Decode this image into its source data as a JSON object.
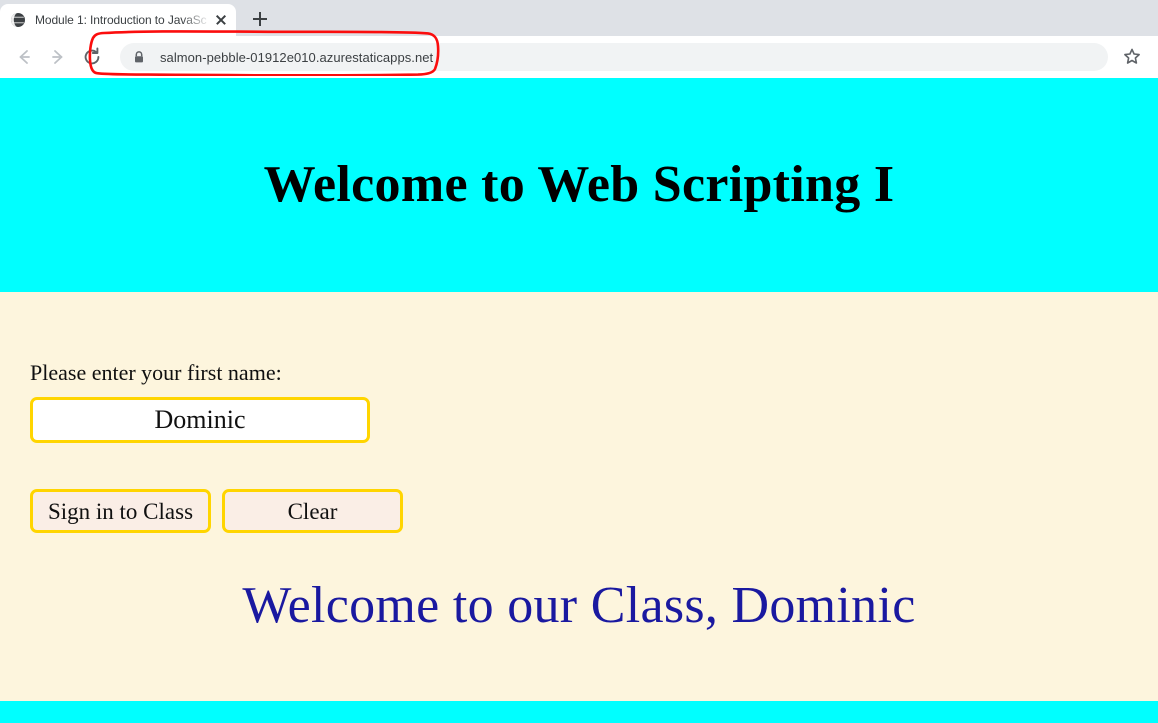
{
  "browser": {
    "tab": {
      "title": "Module 1: Introduction to JavaSc",
      "favicon_name": "globe-icon",
      "close_label": "Close tab"
    },
    "new_tab_label": "New Tab",
    "nav": {
      "back_label": "Back",
      "forward_label": "Forward",
      "reload_label": "Reload"
    },
    "omnibox": {
      "url": "salmon-pebble-01912e010.azurestaticapps.net",
      "security_icon": "lock-icon",
      "placeholder": "Search Google or type a URL"
    },
    "bookmark_label": "Bookmark this tab",
    "annotation": {
      "shape": "hand-drawn-oval",
      "color": "#fb0d0d",
      "target": "address-bar"
    }
  },
  "page": {
    "heading": "Welcome to Web Scripting I",
    "form": {
      "label": "Please enter your first name:",
      "input_value": "Dominic",
      "input_placeholder": "",
      "signin_button": "Sign in to Class",
      "clear_button": "Clear"
    },
    "greeting": "Welcome to our Class, Dominic",
    "colors": {
      "header_band": "#00ffff",
      "body_background": "#fdf5dd",
      "accent_border": "#ffd500",
      "button_background": "#faeee6",
      "greeting_text": "#1a19a0",
      "footer_band": "#00ffff"
    }
  }
}
